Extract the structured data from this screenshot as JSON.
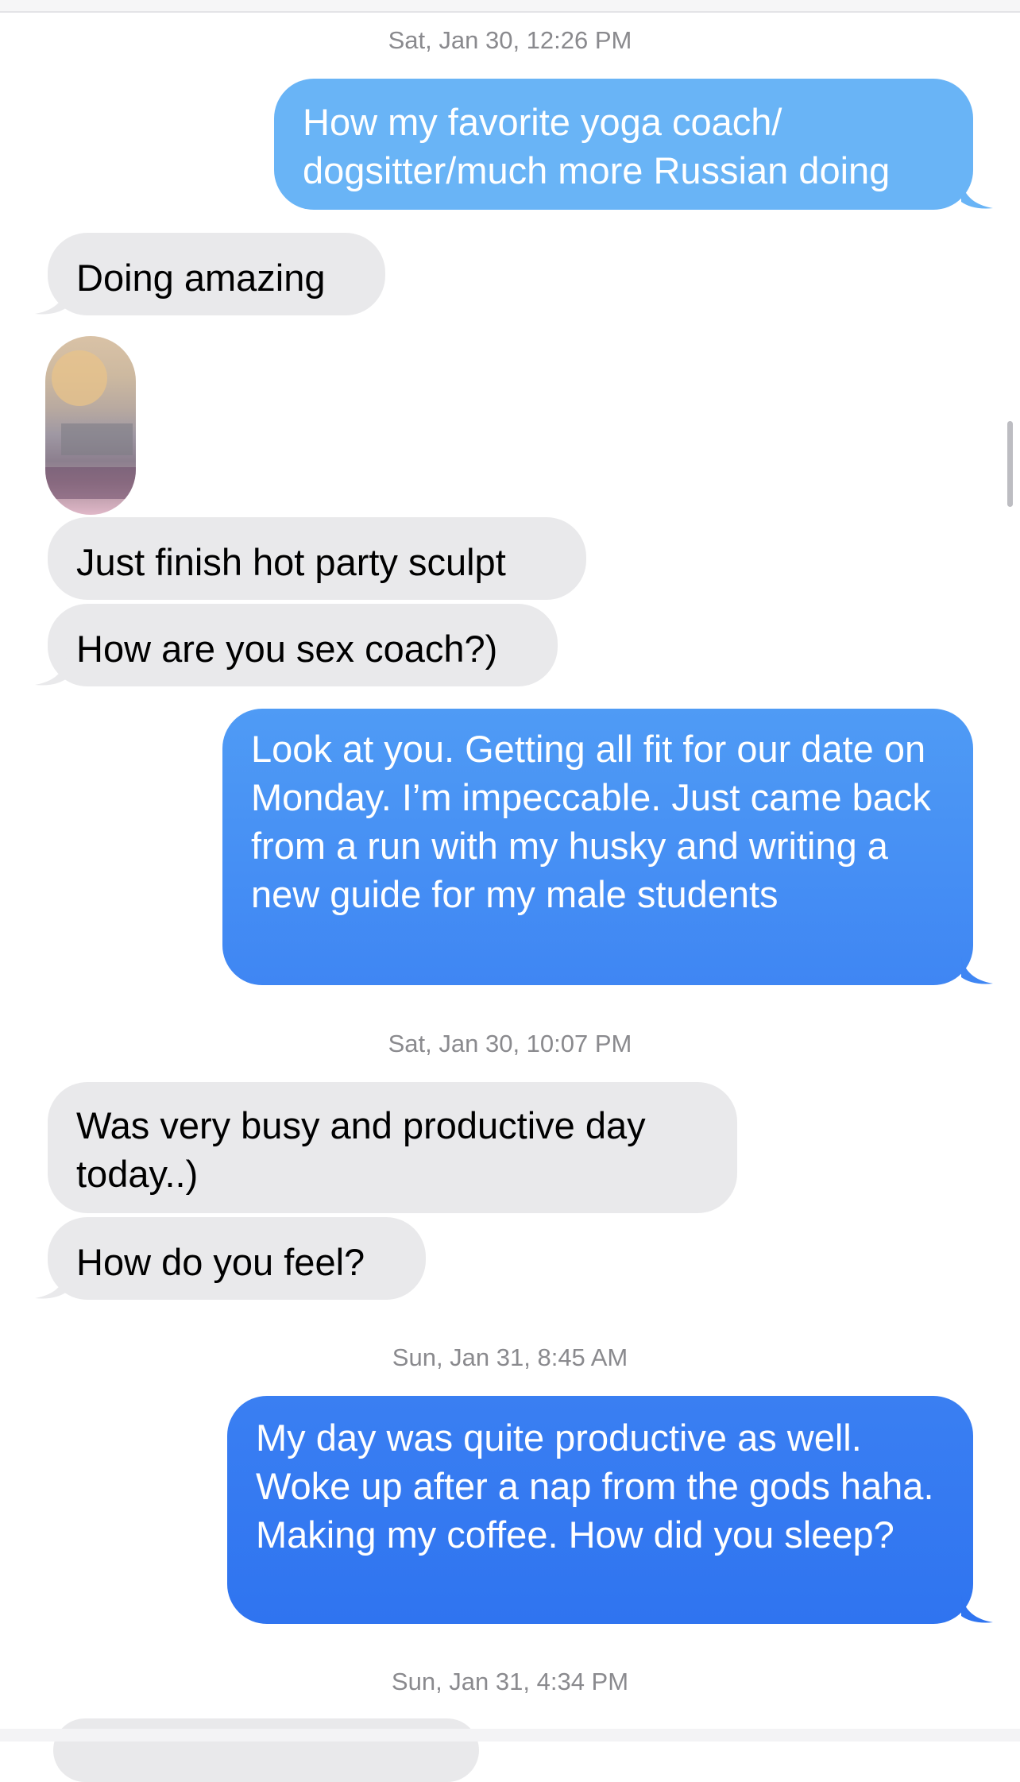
{
  "timestamps": [
    "Sat, Jan 30, 12:26 PM",
    "Sat, Jan 30, 10:07 PM",
    "Sun, Jan 31, 8:45 AM",
    "Sun, Jan 31, 4:34 PM"
  ],
  "messages": [
    {
      "direction": "outgoing",
      "text": "How my favorite yoga coach/ dogsitter/much more Russian doing"
    },
    {
      "direction": "incoming",
      "text": "Doing amazing"
    },
    {
      "direction": "incoming",
      "type": "photo",
      "icon": "blurred-photo-thumbnail"
    },
    {
      "direction": "incoming",
      "text": "Just finish hot party sculpt"
    },
    {
      "direction": "incoming",
      "text": "How are you sex coach?)"
    },
    {
      "direction": "outgoing",
      "text": "Look at you. Getting all fit for our date on Monday. I’m impeccable. Just came back from a run with my husky and writing a new guide for my male students"
    },
    {
      "direction": "incoming",
      "text": "Was very busy and productive day today..)"
    },
    {
      "direction": "incoming",
      "text": "How do you feel?"
    },
    {
      "direction": "outgoing",
      "text": "My day was quite productive as well. Woke up after a nap from the gods haha. Making my coffee. How did you sleep?"
    }
  ],
  "colors": {
    "incoming_bubble": "#e9e9eb",
    "outgoing_top": "#69b4f6",
    "outgoing_bottom": "#2f74f0",
    "timestamp_text": "#8a8a8e"
  }
}
